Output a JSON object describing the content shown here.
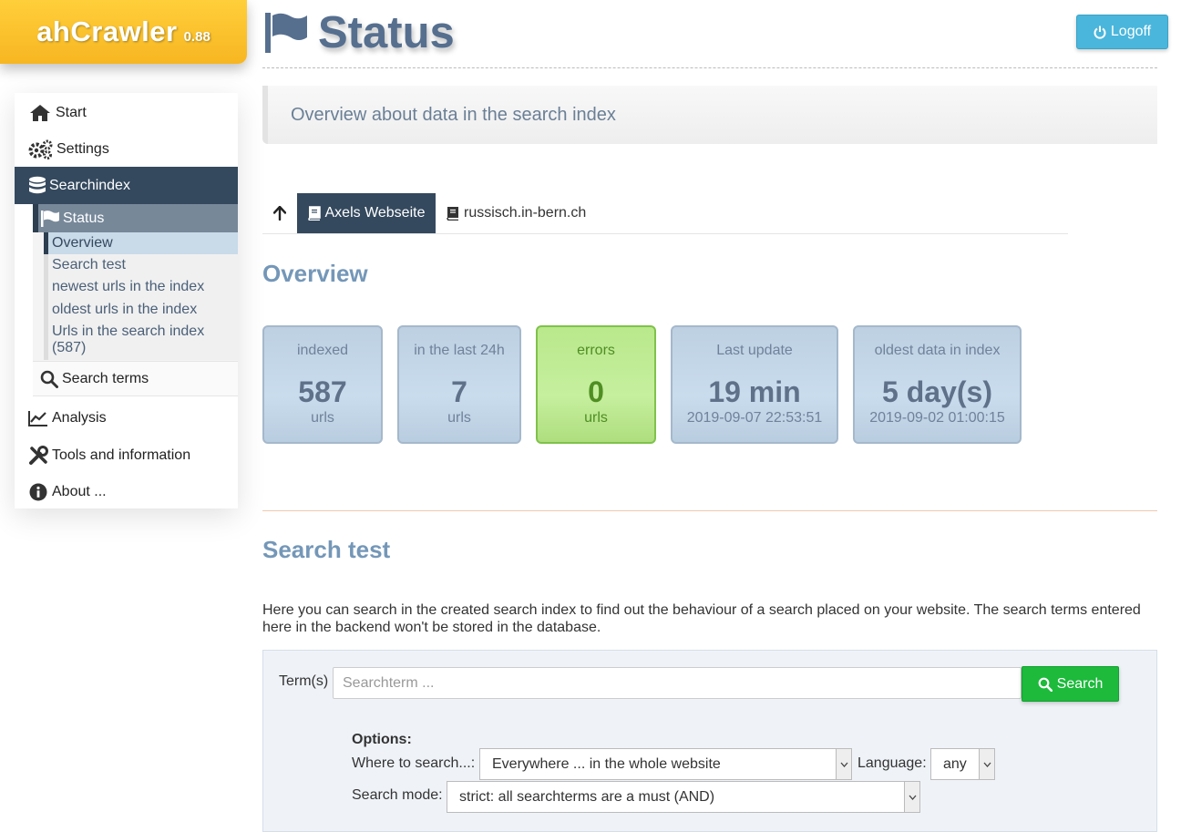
{
  "app": {
    "name": "ahCrawler",
    "version": "0.88"
  },
  "header": {
    "title": "Status",
    "logoff_label": "Logoff"
  },
  "subheader": "Overview about data in the search index",
  "sidebar": {
    "items": [
      {
        "label": "Start",
        "icon": "home-icon"
      },
      {
        "label": "Settings",
        "icon": "gears-icon"
      },
      {
        "label": "Searchindex",
        "icon": "database-icon",
        "active": true
      },
      {
        "label": "Analysis",
        "icon": "chart-line-icon"
      },
      {
        "label": "Tools and information",
        "icon": "tools-icon"
      },
      {
        "label": "About ...",
        "icon": "info-circle-icon"
      }
    ],
    "status": {
      "label": "Status",
      "icon": "flag-icon"
    },
    "status_sub": [
      {
        "label": "Overview",
        "current": true
      },
      {
        "label": "Search test"
      },
      {
        "label": "newest urls in the index"
      },
      {
        "label": "oldest urls in the index"
      },
      {
        "label": "Urls in the search index"
      },
      {
        "label": "(587)"
      }
    ],
    "search_terms": {
      "label": "Search terms",
      "icon": "search-icon"
    }
  },
  "tabs": {
    "up_icon": "arrow-up-icon",
    "items": [
      {
        "label": "Axels Webseite",
        "icon": "book-icon",
        "active": true
      },
      {
        "label": "russisch.in-bern.ch",
        "icon": "book-icon",
        "active": false
      }
    ]
  },
  "overview": {
    "heading": "Overview",
    "tiles": [
      {
        "label": "indexed",
        "value": "587",
        "sub": "urls",
        "status": "info"
      },
      {
        "label": "in the last 24h",
        "value": "7",
        "sub": "urls",
        "status": "info"
      },
      {
        "label": "errors",
        "value": "0",
        "sub": "urls",
        "status": "ok"
      },
      {
        "label": "Last update",
        "value": "19 min",
        "sub": "2019-09-07 22:53:51",
        "status": "info"
      },
      {
        "label": "oldest data in index",
        "value": "5 day(s)",
        "sub": "2019-09-02 01:00:15",
        "status": "info"
      }
    ]
  },
  "search_test": {
    "heading": "Search test",
    "description": "Here you can search in the created search index to find out the behaviour of a search placed on your website. The search terms entered here in the backend won't be stored in the database.",
    "terms_label": "Term(s)",
    "placeholder": "Searchterm ...",
    "button_label": "Search",
    "options_title": "Options:",
    "where_label": "Where to search...:",
    "where_value": "Everywhere ... in the whole website",
    "language_label": "Language:",
    "language_value": "any",
    "mode_label": "Search mode:",
    "mode_value": "strict: all searchterms are a must (AND)"
  },
  "colors": {
    "logo": "#f7b622",
    "active_nav": "#34495e",
    "accent_heading": "#7497b8",
    "info_tile": "#c9dced",
    "ok_tile": "#c6ef9e",
    "logoff_btn": "#4ab6dc",
    "search_btn": "#1dba3c"
  }
}
